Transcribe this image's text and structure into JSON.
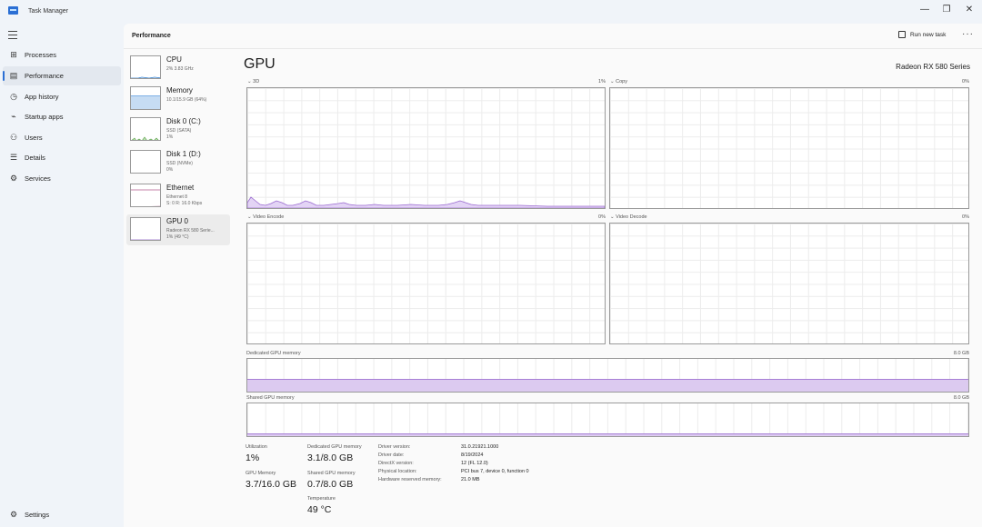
{
  "app": {
    "title": "Task Manager"
  },
  "window_controls": {
    "minimize": "—",
    "restore": "❐",
    "close": "✕"
  },
  "nav": {
    "items": [
      {
        "label": "Processes",
        "icon": "grid-icon",
        "glyph": "⊞"
      },
      {
        "label": "Performance",
        "icon": "pulse-icon",
        "glyph": "▤"
      },
      {
        "label": "App history",
        "icon": "history-icon",
        "glyph": "◷"
      },
      {
        "label": "Startup apps",
        "icon": "speedometer-icon",
        "glyph": "⌁"
      },
      {
        "label": "Users",
        "icon": "users-icon",
        "glyph": "⚇"
      },
      {
        "label": "Details",
        "icon": "list-icon",
        "glyph": "☰"
      },
      {
        "label": "Services",
        "icon": "puzzle-icon",
        "glyph": "⚙"
      }
    ],
    "settings": {
      "label": "Settings",
      "icon": "gear-icon",
      "glyph": "⚙"
    }
  },
  "header": {
    "title": "Performance",
    "run_new_task": "Run new task",
    "more": "···"
  },
  "devices": [
    {
      "name": "CPU",
      "lines": [
        "2%  3.83 GHz"
      ],
      "color": "#2f7fd1"
    },
    {
      "name": "Memory",
      "lines": [
        "10.1/15.9 GB (64%)"
      ],
      "color": "#7fb1e6"
    },
    {
      "name": "Disk 0 (C:)",
      "lines": [
        "SSD (SATA)",
        "1%"
      ],
      "color": "#4d9a3a"
    },
    {
      "name": "Disk 1 (D:)",
      "lines": [
        "SSD (NVMe)",
        "0%"
      ],
      "color": "#4d9a3a"
    },
    {
      "name": "Ethernet",
      "lines": [
        "Ethernet 8",
        "S: 0 R: 16.0 Kbps"
      ],
      "color": "#b05a8b"
    },
    {
      "name": "GPU 0",
      "lines": [
        "Radeon RX 580 Serie...",
        "1% (49 °C)"
      ],
      "color": "#9a6ad0"
    }
  ],
  "gpu": {
    "title": "GPU",
    "model": "Radeon RX 580 Series",
    "graphs": [
      {
        "label": "3D",
        "pct": "1%"
      },
      {
        "label": "Copy",
        "pct": "0%"
      },
      {
        "label": "Video Encode",
        "pct": "0%"
      },
      {
        "label": "Video Decode",
        "pct": "0%"
      }
    ],
    "dedicated": {
      "label": "Dedicated GPU memory",
      "max": "8.0 GB",
      "fraction": 0.39
    },
    "shared": {
      "label": "Shared GPU memory",
      "max": "8.0 GB",
      "fraction": 0.09
    },
    "stats": {
      "utilization": {
        "label": "Utilization",
        "value": "1%"
      },
      "gpu_memory": {
        "label": "GPU Memory",
        "value": "3.7/16.0 GB"
      },
      "dedicated": {
        "label": "Dedicated GPU memory",
        "value": "3.1/8.0 GB"
      },
      "shared": {
        "label": "Shared GPU memory",
        "value": "0.7/8.0 GB"
      },
      "temperature": {
        "label": "Temperature",
        "value": "49 °C"
      }
    },
    "info": [
      {
        "key": "Driver version:",
        "value": "31.0.21921.1000"
      },
      {
        "key": "Driver date:",
        "value": "8/19/2024"
      },
      {
        "key": "DirectX version:",
        "value": "12 (FL 12.0)"
      },
      {
        "key": "Physical location:",
        "value": "PCI bus 7, device 0, function 0"
      },
      {
        "key": "Hardware reserved memory:",
        "value": "21.0 MB"
      }
    ]
  },
  "colors": {
    "gpu_accent": "#9a6ad0",
    "gpu_fill": "#dccaf0",
    "nav_accent": "#2b6fd4"
  }
}
